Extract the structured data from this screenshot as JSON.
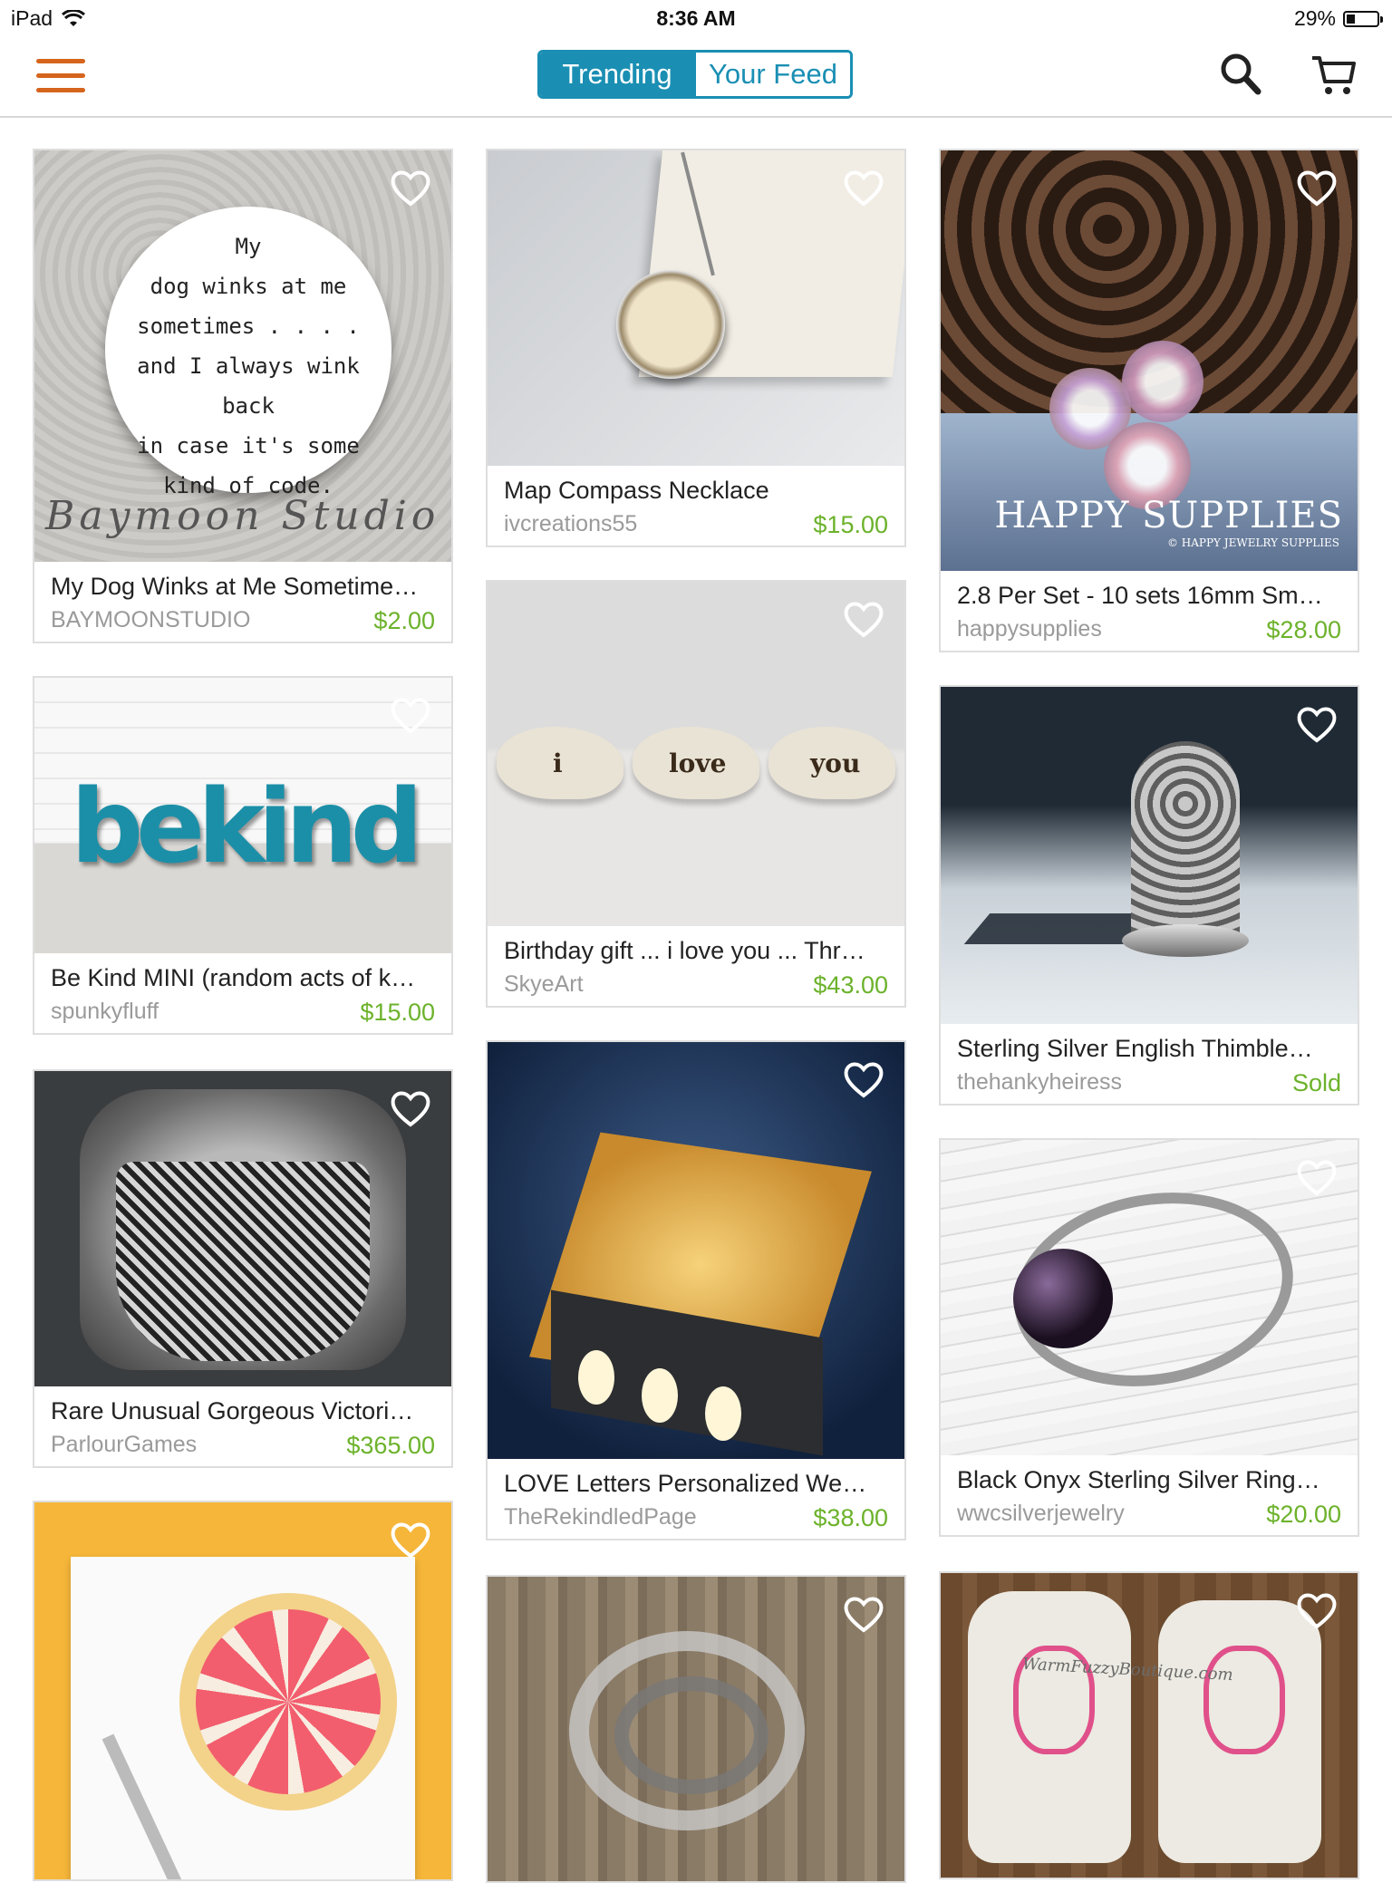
{
  "status_bar": {
    "device": "iPad",
    "time": "8:36 AM",
    "battery": "29%"
  },
  "nav": {
    "tabs": [
      "Trending",
      "Your Feed"
    ],
    "active_tab": "Trending",
    "icons": [
      "menu-icon",
      "search-icon",
      "cart-icon"
    ],
    "accent_color": "#1a8fb3",
    "menu_color": "#d5641c"
  },
  "listings": [
    {
      "title": "My Dog Winks at Me Sometime…",
      "shop": "BAYMOONSTUDIO",
      "price": "$2.00",
      "image_text": [
        "My",
        "dog winks at me",
        "sometimes . . . .",
        "and I always wink back",
        "in case it's some",
        "kind of code."
      ],
      "image_brand": "Baymoon Studio"
    },
    {
      "title": "Be Kind MINI (random acts of k…",
      "shop": "spunkyfluff",
      "price": "$15.00",
      "image_text": "bekind"
    },
    {
      "title": "Rare Unusual Gorgeous Victori…",
      "shop": "ParlourGames",
      "price": "$365.00"
    },
    {
      "title": "",
      "shop": "",
      "price": ""
    },
    {
      "title": "Map Compass Necklace",
      "shop": "ivcreations55",
      "price": "$15.00"
    },
    {
      "title": "Birthday gift ... i love you ... Thr…",
      "shop": "SkyeArt",
      "price": "$43.00",
      "image_text": [
        "i",
        "love",
        "you"
      ]
    },
    {
      "title": "LOVE Letters Personalized We…",
      "shop": "TheRekindledPage",
      "price": "$38.00"
    },
    {
      "title": "",
      "shop": "",
      "price": ""
    },
    {
      "title": "2.8 Per Set - 10 sets 16mm Sm…",
      "shop": "happysupplies",
      "price": "$28.00",
      "image_brand": "HAPPY SUPPLIES",
      "image_sub": "© HAPPY JEWELRY SUPPLIES"
    },
    {
      "title": "Sterling Silver English Thimble…",
      "shop": "thehankyheiress",
      "price": "Sold"
    },
    {
      "title": "Black Onyx Sterling Silver Ring…",
      "shop": "wwcsilverjewelry",
      "price": "$20.00"
    },
    {
      "title": "",
      "shop": "",
      "price": "",
      "image_text": "WarmFuzzyBoutique.com"
    }
  ]
}
